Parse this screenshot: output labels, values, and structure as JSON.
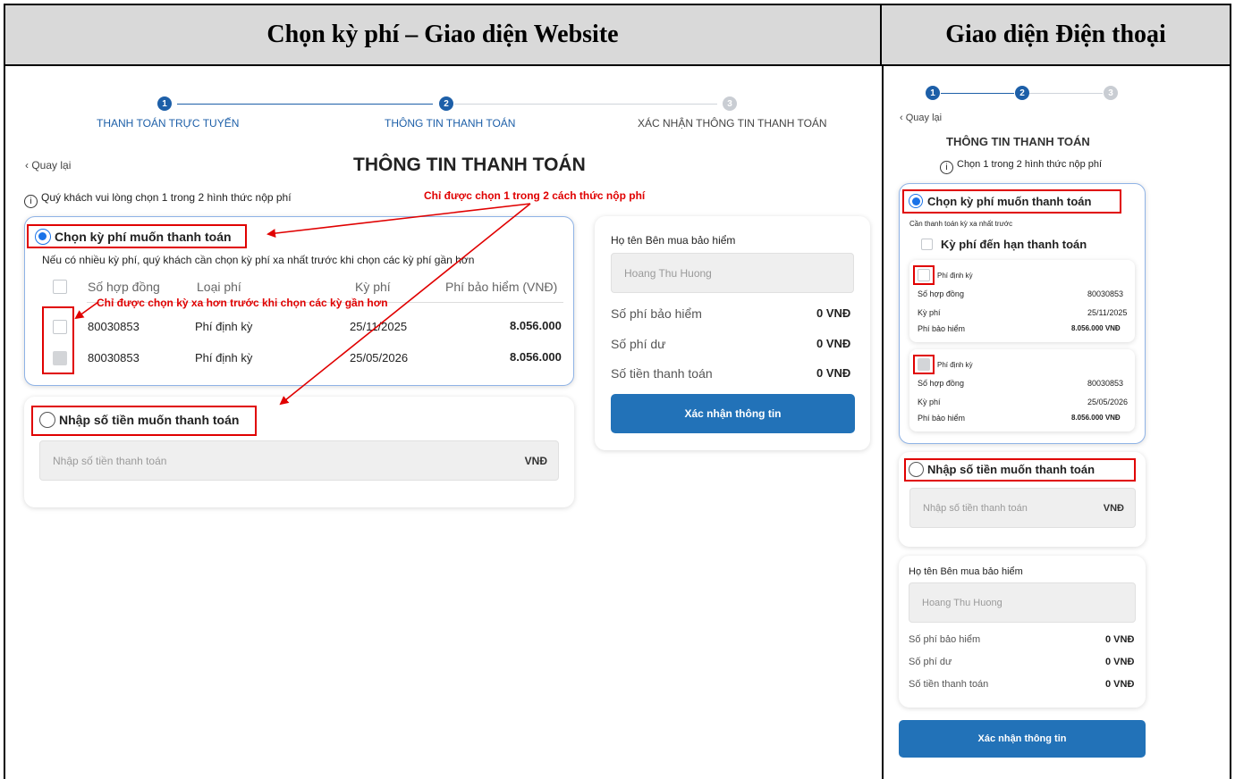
{
  "headers": {
    "web": "Chọn kỳ phí – Giao diện Website",
    "mobile": "Giao diện Điện thoại"
  },
  "steps": {
    "numbers": [
      "1",
      "2",
      "3"
    ],
    "labels": [
      "THANH TOÁN TRỰC TUYẾN",
      "THÔNG TIN THANH TOÁN",
      "XÁC NHẬN THÔNG TIN THANH TOÁN"
    ]
  },
  "back_label": "Quay lại",
  "page_title": "THÔNG TIN THANH TOÁN",
  "info_text_web": "Quý khách vui lòng chọn 1 trong 2 hình thức nộp phí",
  "info_text_mobile": "Chọn 1 trong 2 hình thức nộp phí",
  "annotations": {
    "one_of_two": "Chỉ được chọn 1 trong 2 cách thức nộp phí",
    "far_first": "Chỉ được chọn kỳ xa hơn trước khi chọn các kỳ gần hơn"
  },
  "option1": {
    "title": "Chọn kỳ phí muốn thanh toán",
    "hint_web": "Nếu có nhiều kỳ phí, quý khách cần chọn kỳ phí xa nhất trước khi chọn các kỳ phí gần hơn",
    "hint_mobile": "Cần thanh toán kỳ xa nhất trước",
    "due_label": "Kỳ phí đến hạn thanh toán",
    "columns": [
      "Số hợp đồng",
      "Loại phí",
      "Kỳ phí",
      "Phí bảo hiểm (VNĐ)"
    ],
    "rows": [
      {
        "contract": "80030853",
        "type": "Phí định kỳ",
        "period": "25/11/2025",
        "premium": "8.056.000",
        "premium_mobile": "8.056.000 VNĐ"
      },
      {
        "contract": "80030853",
        "type": "Phí định kỳ",
        "period": "25/05/2026",
        "premium": "8.056.000",
        "premium_mobile": "8.056.000 VNĐ"
      }
    ],
    "mobile_field_labels": {
      "contract": "Số hợp đồng",
      "period": "Kỳ phí",
      "premium": "Phí bảo hiểm"
    }
  },
  "option2": {
    "title": "Nhập số tiền muốn thanh toán",
    "placeholder": "Nhập số tiền thanh toán",
    "unit": "VNĐ"
  },
  "summary": {
    "buyer_label": "Họ tên Bên mua bảo hiểm",
    "buyer_value": "Hoang Thu Huong",
    "lines": [
      {
        "label": "Số phí bảo hiểm",
        "value": "0 VNĐ"
      },
      {
        "label": "Số phí dư",
        "value": "0 VNĐ"
      },
      {
        "label": "Số tiền thanh toán",
        "value": "0 VNĐ"
      }
    ],
    "confirm_button": "Xác nhận thông tin"
  },
  "colors": {
    "primary": "#2272b8",
    "annotation": "#e00000",
    "step_active": "#1d5fa8"
  }
}
